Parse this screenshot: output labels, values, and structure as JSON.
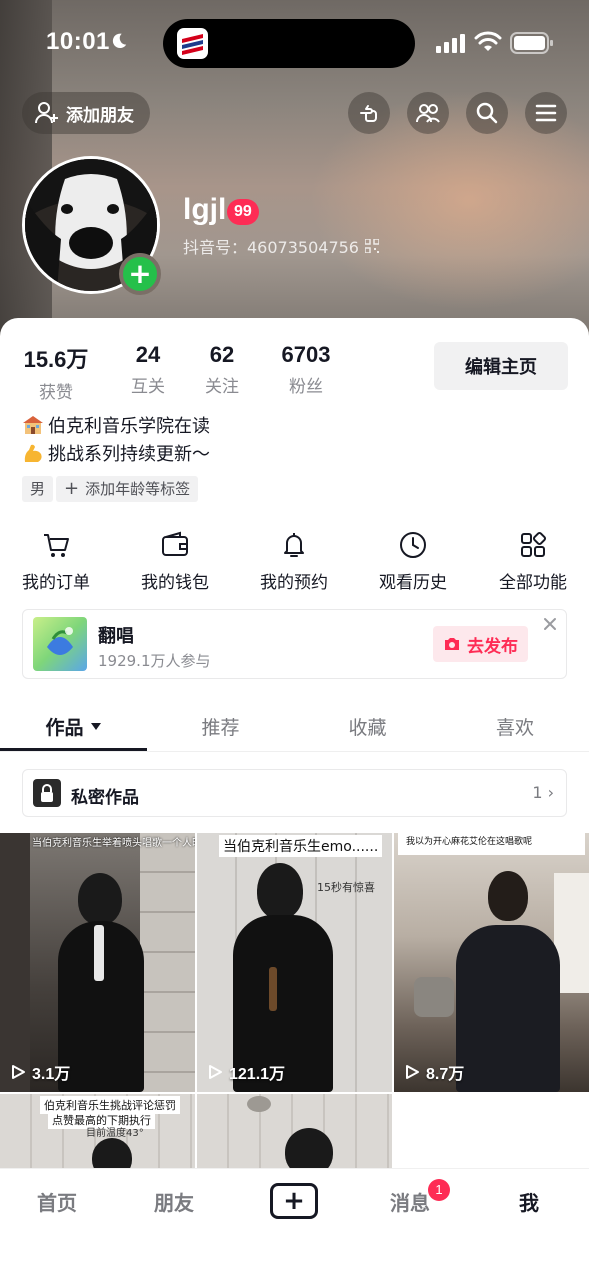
{
  "status_bar": {
    "time": "10:01"
  },
  "header": {
    "add_friend_label": "添加朋友"
  },
  "profile": {
    "username": "lgjl",
    "level": "99",
    "douyin_id": "抖音号：46073504756"
  },
  "stats": [
    {
      "value": "15.6万",
      "label": "获赞"
    },
    {
      "value": "24",
      "label": "互关"
    },
    {
      "value": "62",
      "label": "关注"
    },
    {
      "value": "6703",
      "label": "粉丝"
    }
  ],
  "edit_profile_label": "编辑主页",
  "bio": {
    "line1": "伯克利音乐学院在读",
    "line2": "挑战系列持续更新～"
  },
  "tags": {
    "gender": "男",
    "add_tag": "添加年龄等标签"
  },
  "functions": [
    {
      "label": "我的订单",
      "icon": "cart-icon"
    },
    {
      "label": "我的钱包",
      "icon": "wallet-icon"
    },
    {
      "label": "我的预约",
      "icon": "bell-icon"
    },
    {
      "label": "观看历史",
      "icon": "clock-icon"
    },
    {
      "label": "全部功能",
      "icon": "grid-icon"
    }
  ],
  "promo": {
    "title": "翻唱",
    "subtitle": "1929.1万人参与",
    "button": "去发布"
  },
  "tabs": [
    {
      "label": "作品"
    },
    {
      "label": "推荐"
    },
    {
      "label": "收藏"
    },
    {
      "label": "喜欢"
    }
  ],
  "private_works": {
    "label": "私密作品",
    "count": "1"
  },
  "videos": [
    {
      "plays": "3.1万",
      "caption": "当伯克利音乐生举着喷头唱歌一个人时"
    },
    {
      "plays": "121.1万",
      "caption": "当伯克利音乐生emo......",
      "sub_caption": "15秒有惊喜"
    },
    {
      "plays": "8.7万",
      "caption": "我以为开心麻花艾伦在这唱歌呢"
    },
    {
      "caption": "伯克利音乐生挑战评论惩罚",
      "caption2": "点赞最高的下期执行",
      "sub_caption": "目前温度43°"
    },
    {}
  ],
  "bottom_nav": {
    "home": "首页",
    "friends": "朋友",
    "create": "+",
    "messages": "消息",
    "messages_badge": "1",
    "me": "我"
  },
  "colors": {
    "accent": "#fe2c55",
    "text": "#161823",
    "muted": "#8a8b91"
  }
}
